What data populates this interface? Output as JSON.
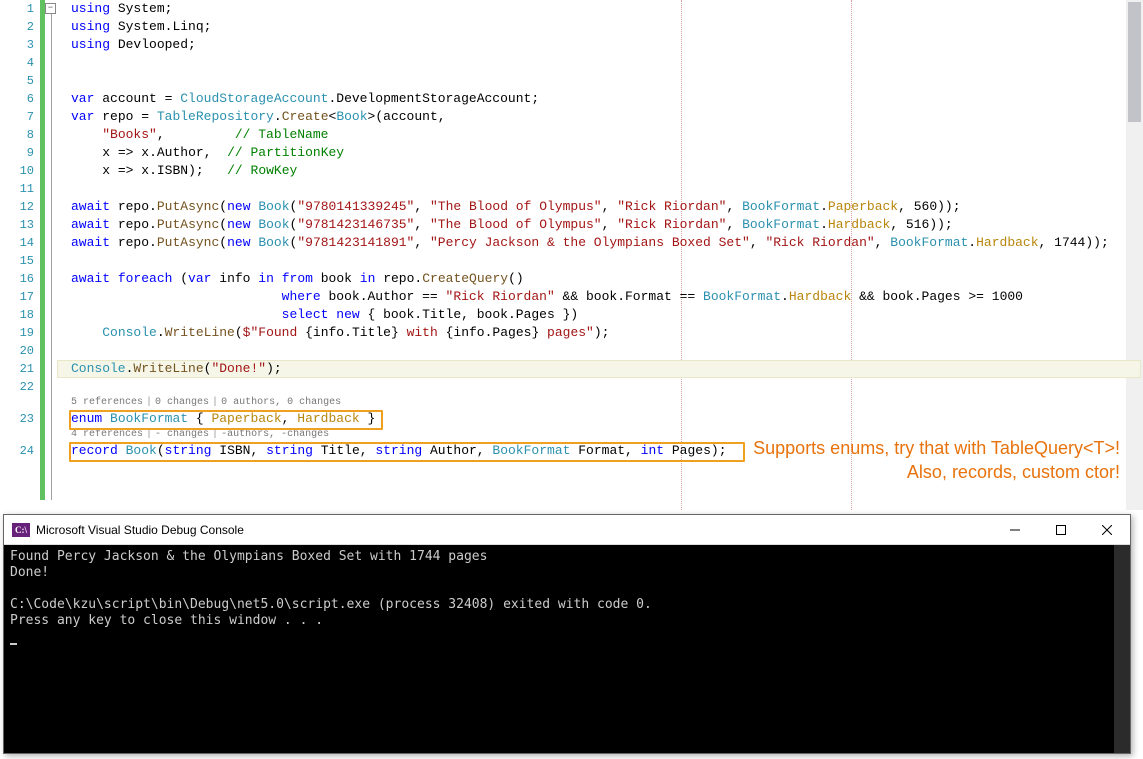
{
  "lines": {
    "l1": [
      [
        "kw",
        "using"
      ],
      [
        "op",
        " "
      ],
      [
        "id",
        "System"
      ],
      [
        "op",
        ";"
      ]
    ],
    "l2": [
      [
        "kw",
        "using"
      ],
      [
        "op",
        " "
      ],
      [
        "id",
        "System"
      ],
      [
        "op",
        "."
      ],
      [
        "id",
        "Linq"
      ],
      [
        "op",
        ";"
      ]
    ],
    "l3": [
      [
        "kw",
        "using"
      ],
      [
        "op",
        " "
      ],
      [
        "id",
        "Devlooped"
      ],
      [
        "op",
        ";"
      ]
    ],
    "l4": [],
    "l5": [],
    "l6": [
      [
        "kw",
        "var"
      ],
      [
        "op",
        " "
      ],
      [
        "id",
        "account"
      ],
      [
        "op",
        " = "
      ],
      [
        "ty",
        "CloudStorageAccount"
      ],
      [
        "op",
        "."
      ],
      [
        "id",
        "DevelopmentStorageAccount"
      ],
      [
        "op",
        ";"
      ]
    ],
    "l7": [
      [
        "kw",
        "var"
      ],
      [
        "op",
        " "
      ],
      [
        "id",
        "repo"
      ],
      [
        "op",
        " = "
      ],
      [
        "ty",
        "TableRepository"
      ],
      [
        "op",
        "."
      ],
      [
        "mth",
        "Create"
      ],
      [
        "op",
        "<"
      ],
      [
        "ty",
        "Book"
      ],
      [
        "op",
        ">("
      ],
      [
        "id",
        "account"
      ],
      [
        "op",
        ","
      ]
    ],
    "l8": [
      [
        "op",
        "    "
      ],
      [
        "str",
        "\"Books\""
      ],
      [
        "op",
        ",         "
      ],
      [
        "cm",
        "// TableName"
      ]
    ],
    "l9": [
      [
        "op",
        "    "
      ],
      [
        "id",
        "x"
      ],
      [
        "op",
        " => "
      ],
      [
        "id",
        "x"
      ],
      [
        "op",
        "."
      ],
      [
        "id",
        "Author"
      ],
      [
        "op",
        ",  "
      ],
      [
        "cm",
        "// PartitionKey"
      ]
    ],
    "l10": [
      [
        "op",
        "    "
      ],
      [
        "id",
        "x"
      ],
      [
        "op",
        " => "
      ],
      [
        "id",
        "x"
      ],
      [
        "op",
        "."
      ],
      [
        "id",
        "ISBN"
      ],
      [
        "op",
        ");   "
      ],
      [
        "cm",
        "// RowKey"
      ]
    ],
    "l11": [],
    "l12": [
      [
        "kw",
        "await"
      ],
      [
        "op",
        " "
      ],
      [
        "id",
        "repo"
      ],
      [
        "op",
        "."
      ],
      [
        "mth",
        "PutAsync"
      ],
      [
        "op",
        "("
      ],
      [
        "kw",
        "new"
      ],
      [
        "op",
        " "
      ],
      [
        "ty",
        "Book"
      ],
      [
        "op",
        "("
      ],
      [
        "str",
        "\"9780141339245\""
      ],
      [
        "op",
        ", "
      ],
      [
        "str",
        "\"The Blood of Olympus\""
      ],
      [
        "op",
        ", "
      ],
      [
        "str",
        "\"Rick Riordan\""
      ],
      [
        "op",
        ", "
      ],
      [
        "ty",
        "BookFormat"
      ],
      [
        "op",
        "."
      ],
      [
        "en",
        "Paperback"
      ],
      [
        "op",
        ", "
      ],
      [
        "num",
        "560"
      ],
      [
        "op",
        "));"
      ]
    ],
    "l13": [
      [
        "kw",
        "await"
      ],
      [
        "op",
        " "
      ],
      [
        "id",
        "repo"
      ],
      [
        "op",
        "."
      ],
      [
        "mth",
        "PutAsync"
      ],
      [
        "op",
        "("
      ],
      [
        "kw",
        "new"
      ],
      [
        "op",
        " "
      ],
      [
        "ty",
        "Book"
      ],
      [
        "op",
        "("
      ],
      [
        "str",
        "\"9781423146735\""
      ],
      [
        "op",
        ", "
      ],
      [
        "str",
        "\"The Blood of Olympus\""
      ],
      [
        "op",
        ", "
      ],
      [
        "str",
        "\"Rick Riordan\""
      ],
      [
        "op",
        ", "
      ],
      [
        "ty",
        "BookFormat"
      ],
      [
        "op",
        "."
      ],
      [
        "en",
        "Hardback"
      ],
      [
        "op",
        ", "
      ],
      [
        "num",
        "516"
      ],
      [
        "op",
        "));"
      ]
    ],
    "l14": [
      [
        "kw",
        "await"
      ],
      [
        "op",
        " "
      ],
      [
        "id",
        "repo"
      ],
      [
        "op",
        "."
      ],
      [
        "mth",
        "PutAsync"
      ],
      [
        "op",
        "("
      ],
      [
        "kw",
        "new"
      ],
      [
        "op",
        " "
      ],
      [
        "ty",
        "Book"
      ],
      [
        "op",
        "("
      ],
      [
        "str",
        "\"9781423141891\""
      ],
      [
        "op",
        ", "
      ],
      [
        "str",
        "\"Percy Jackson & the Olympians Boxed Set\""
      ],
      [
        "op",
        ", "
      ],
      [
        "str",
        "\"Rick Riordan\""
      ],
      [
        "op",
        ", "
      ],
      [
        "ty",
        "BookFormat"
      ],
      [
        "op",
        "."
      ],
      [
        "en",
        "Hardback"
      ],
      [
        "op",
        ", "
      ],
      [
        "num",
        "1744"
      ],
      [
        "op",
        "));"
      ]
    ],
    "l15": [],
    "l16": [
      [
        "kw",
        "await"
      ],
      [
        "op",
        " "
      ],
      [
        "kw",
        "foreach"
      ],
      [
        "op",
        " ("
      ],
      [
        "kw",
        "var"
      ],
      [
        "op",
        " "
      ],
      [
        "id",
        "info"
      ],
      [
        "op",
        " "
      ],
      [
        "kw",
        "in"
      ],
      [
        "op",
        " "
      ],
      [
        "kw",
        "from"
      ],
      [
        "op",
        " "
      ],
      [
        "id",
        "book"
      ],
      [
        "op",
        " "
      ],
      [
        "kw",
        "in"
      ],
      [
        "op",
        " "
      ],
      [
        "id",
        "repo"
      ],
      [
        "op",
        "."
      ],
      [
        "mth",
        "CreateQuery"
      ],
      [
        "op",
        "()"
      ]
    ],
    "l17": [
      [
        "op",
        "                           "
      ],
      [
        "kw",
        "where"
      ],
      [
        "op",
        " "
      ],
      [
        "id",
        "book"
      ],
      [
        "op",
        "."
      ],
      [
        "id",
        "Author"
      ],
      [
        "op",
        " == "
      ],
      [
        "str",
        "\"Rick Riordan\""
      ],
      [
        "op",
        " && "
      ],
      [
        "id",
        "book"
      ],
      [
        "op",
        "."
      ],
      [
        "id",
        "Format"
      ],
      [
        "op",
        " == "
      ],
      [
        "ty",
        "BookFormat"
      ],
      [
        "op",
        "."
      ],
      [
        "en",
        "Hardback"
      ],
      [
        "op",
        " && "
      ],
      [
        "id",
        "book"
      ],
      [
        "op",
        "."
      ],
      [
        "id",
        "Pages"
      ],
      [
        "op",
        " >= "
      ],
      [
        "num",
        "1000"
      ]
    ],
    "l18": [
      [
        "op",
        "                           "
      ],
      [
        "kw",
        "select"
      ],
      [
        "op",
        " "
      ],
      [
        "kw",
        "new"
      ],
      [
        "op",
        " { "
      ],
      [
        "id",
        "book"
      ],
      [
        "op",
        "."
      ],
      [
        "id",
        "Title"
      ],
      [
        "op",
        ", "
      ],
      [
        "id",
        "book"
      ],
      [
        "op",
        "."
      ],
      [
        "id",
        "Pages"
      ],
      [
        "op",
        " })"
      ]
    ],
    "l19": [
      [
        "op",
        "    "
      ],
      [
        "ty",
        "Console"
      ],
      [
        "op",
        "."
      ],
      [
        "mth",
        "WriteLine"
      ],
      [
        "op",
        "("
      ],
      [
        "str",
        "$\"Found "
      ],
      [
        "op",
        "{"
      ],
      [
        "id",
        "info"
      ],
      [
        "op",
        "."
      ],
      [
        "id",
        "Title"
      ],
      [
        "op",
        "}"
      ],
      [
        "str",
        " with "
      ],
      [
        "op",
        "{"
      ],
      [
        "id",
        "info"
      ],
      [
        "op",
        "."
      ],
      [
        "id",
        "Pages"
      ],
      [
        "op",
        "}"
      ],
      [
        "str",
        " pages\""
      ],
      [
        "op",
        ");"
      ]
    ],
    "l20": [],
    "l21": [
      [
        "ty",
        "Console"
      ],
      [
        "op",
        "."
      ],
      [
        "mth",
        "WriteLine"
      ],
      [
        "op",
        "("
      ],
      [
        "str",
        "\"Done!\""
      ],
      [
        "op",
        ");"
      ]
    ],
    "l22": [],
    "l23": [
      [
        "kw",
        "enum"
      ],
      [
        "op",
        " "
      ],
      [
        "ty",
        "BookFormat"
      ],
      [
        "op",
        " { "
      ],
      [
        "en",
        "Paperback"
      ],
      [
        "op",
        ", "
      ],
      [
        "en",
        "Hardback"
      ],
      [
        "op",
        " }"
      ]
    ],
    "l24": [
      [
        "kw",
        "record"
      ],
      [
        "op",
        " "
      ],
      [
        "ty",
        "Book"
      ],
      [
        "op",
        "("
      ],
      [
        "kw",
        "string"
      ],
      [
        "op",
        " "
      ],
      [
        "id",
        "ISBN"
      ],
      [
        "op",
        ", "
      ],
      [
        "kw",
        "string"
      ],
      [
        "op",
        " "
      ],
      [
        "id",
        "Title"
      ],
      [
        "op",
        ", "
      ],
      [
        "kw",
        "string"
      ],
      [
        "op",
        " "
      ],
      [
        "id",
        "Author"
      ],
      [
        "op",
        ", "
      ],
      [
        "ty",
        "BookFormat"
      ],
      [
        "op",
        " "
      ],
      [
        "id",
        "Format"
      ],
      [
        "op",
        ", "
      ],
      [
        "kw",
        "int"
      ],
      [
        "op",
        " "
      ],
      [
        "id",
        "Pages"
      ],
      [
        "op",
        ");"
      ]
    ]
  },
  "codelens": {
    "cl1": [
      "5 references",
      "0 changes",
      "0 authors, 0 changes"
    ],
    "cl2": [
      "4 references",
      "- changes",
      "-authors, -changes"
    ]
  },
  "line_numbers": [
    1,
    2,
    3,
    4,
    5,
    6,
    7,
    8,
    9,
    10,
    11,
    12,
    13,
    14,
    15,
    16,
    17,
    18,
    19,
    20,
    21,
    22,
    23,
    24
  ],
  "annotation": {
    "line1": "Supports enums, try that with TableQuery<T>!",
    "line2": "Also, records, custom ctor!"
  },
  "console": {
    "title": "Microsoft Visual Studio Debug Console",
    "icon_text": "C:\\",
    "output": "Found Percy Jackson & the Olympians Boxed Set with 1744 pages\nDone!\n\nC:\\Code\\kzu\\script\\bin\\Debug\\net5.0\\script.exe (process 32408) exited with code 0.\nPress any key to close this window . . .\n"
  }
}
